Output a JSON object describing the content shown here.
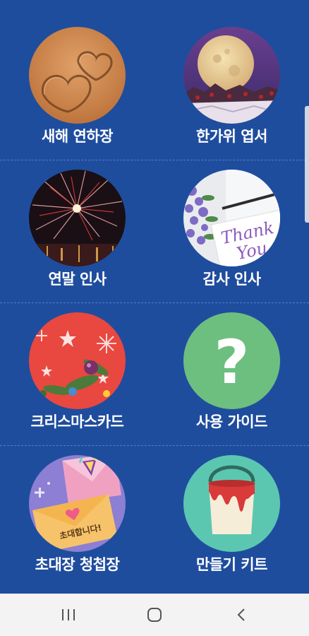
{
  "menu": {
    "items": [
      {
        "label": "새해 연하장",
        "icon": "sand-heart-photo"
      },
      {
        "label": "한가위 엽서",
        "icon": "full-moon-photo"
      },
      {
        "label": "연말 인사",
        "icon": "fireworks-photo"
      },
      {
        "label": "감사 인사",
        "icon": "thank-you-card-photo"
      },
      {
        "label": "크리스마스카드",
        "icon": "christmas-ornaments-photo"
      },
      {
        "label": "사용 가이드",
        "icon": "question-mark-icon"
      },
      {
        "label": "초대장 청첩장",
        "icon": "invitation-envelope-icon"
      },
      {
        "label": "만들기 키트",
        "icon": "paint-bucket-icon"
      }
    ],
    "invitation_text": "초대합니다!",
    "thank_text": "Thank",
    "you_text": "You",
    "question_glyph": "?"
  },
  "navbar": {
    "icons": [
      "recent-apps-icon",
      "home-icon",
      "back-icon"
    ]
  },
  "colors": {
    "background": "#1f4d9e",
    "label": "#ffffff",
    "guide_circle": "#6dbf7f",
    "kit_circle": "#5cc7b0"
  }
}
